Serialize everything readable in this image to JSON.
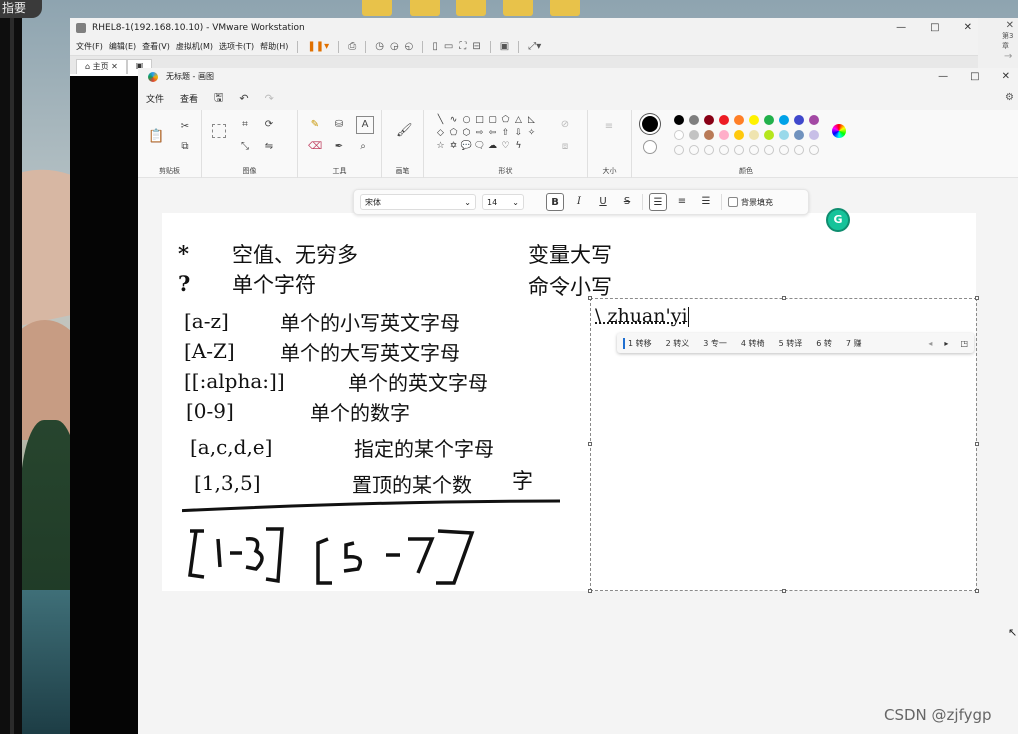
{
  "desktop": {
    "corner_tab": "指要"
  },
  "vmware": {
    "title": "RHEL8-1(192.168.10.10) - VMware Workstation",
    "controls": [
      "—",
      "□",
      "✕"
    ],
    "menu": [
      "文件(F)",
      "编辑(E)",
      "查看(V)",
      "虚拟机(M)",
      "选项卡(T)",
      "帮助(H)"
    ],
    "tabs": [
      "主页"
    ],
    "side_peek": "第3章"
  },
  "paint": {
    "title": "无标题 - 画图",
    "controls": [
      "—",
      "□",
      "✕"
    ],
    "menu": {
      "file": "文件",
      "view": "查看"
    },
    "groups": {
      "clipboard": "剪贴板",
      "image": "图像",
      "tools": "工具",
      "brushes": "画笔",
      "shapes": "形状",
      "size": "大小",
      "colors": "颜色"
    },
    "text_toolbar": {
      "font": "宋体",
      "size": "14",
      "bold": "B",
      "italic": "I",
      "underline": "U",
      "strike": "S",
      "fill_label": "背景填充"
    },
    "palette": [
      "#000000",
      "#7f7f7f",
      "#880015",
      "#ed1c24",
      "#ff7f27",
      "#fff200",
      "#22b14c",
      "#00a2e8",
      "#3f48cc",
      "#a349a4",
      "#ffffff",
      "#c3c3c3",
      "#b97a57",
      "#ffaec9",
      "#ffc90e",
      "#efe4b0",
      "#b5e61d",
      "#99d9ea",
      "#7092be",
      "#c8bfe7"
    ]
  },
  "canvas": {
    "lines": [
      {
        "pattern": "*",
        "desc": "空值、无穷多"
      },
      {
        "pattern": "?",
        "desc": "单个字符"
      },
      {
        "pattern": "[a-z]",
        "desc": "单个的小写英文字母"
      },
      {
        "pattern": "[A-Z]",
        "desc": "单个的大写英文字母"
      },
      {
        "pattern": "[[:alpha:]]",
        "desc": "单个的英文字母"
      },
      {
        "pattern": "[0-9]",
        "desc": "单个的数字"
      },
      {
        "pattern": "[a,c,d,e]",
        "desc": "指定的某个字母"
      },
      {
        "pattern": "[1,3,5]",
        "desc": "置顶的某个数",
        "extra": "字"
      }
    ],
    "right_notes": [
      "变量大写",
      "命令小写"
    ],
    "handwriting": "[1-3]  [5-7]",
    "textbox_text": "\\ zhuan'yi"
  },
  "ime": {
    "candidates": [
      "1 转移",
      "2 转义",
      "3 专一",
      "4 转椅",
      "5 转译",
      "6 转",
      "7 赚"
    ]
  },
  "grammarly": "G",
  "watermark": "CSDN @zjfygp"
}
